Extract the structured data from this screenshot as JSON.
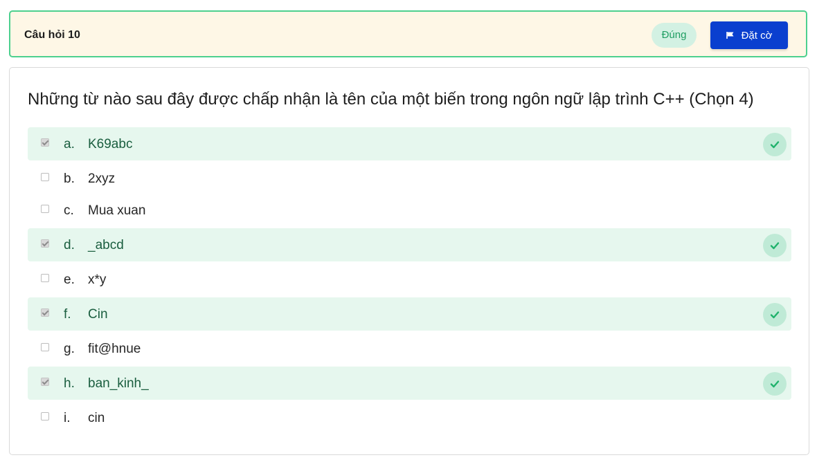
{
  "header": {
    "title": "Câu hỏi 10",
    "status": "Đúng",
    "flag_label": "Đặt cờ"
  },
  "question": {
    "text": "Những từ nào sau đây được chấp nhận là tên của một biến trong ngôn ngữ lập trình C++ (Chọn 4)"
  },
  "answers": [
    {
      "letter": "a.",
      "text": "K69abc",
      "checked": true,
      "correct": true
    },
    {
      "letter": "b.",
      "text": "2xyz",
      "checked": false,
      "correct": false
    },
    {
      "letter": "c.",
      "text": "Mua xuan",
      "checked": false,
      "correct": false
    },
    {
      "letter": "d.",
      "text": "_abcd",
      "checked": true,
      "correct": true
    },
    {
      "letter": "e.",
      "text": "x*y",
      "checked": false,
      "correct": false
    },
    {
      "letter": "f.",
      "text": "Cin",
      "checked": true,
      "correct": true
    },
    {
      "letter": "g.",
      "text": "fit@hnue",
      "checked": false,
      "correct": false
    },
    {
      "letter": "h.",
      "text": "ban_kinh_",
      "checked": true,
      "correct": true
    },
    {
      "letter": "i.",
      "text": "cin",
      "checked": false,
      "correct": false
    }
  ],
  "colors": {
    "header_border": "#4cd08e",
    "header_bg": "#fef7e6",
    "flag_button_bg": "#0a3fcf",
    "correct_bg": "#e6f7ee",
    "correct_icon": "#1fb26b"
  },
  "icons": {
    "flag": "flag-icon",
    "correct": "check-icon"
  }
}
